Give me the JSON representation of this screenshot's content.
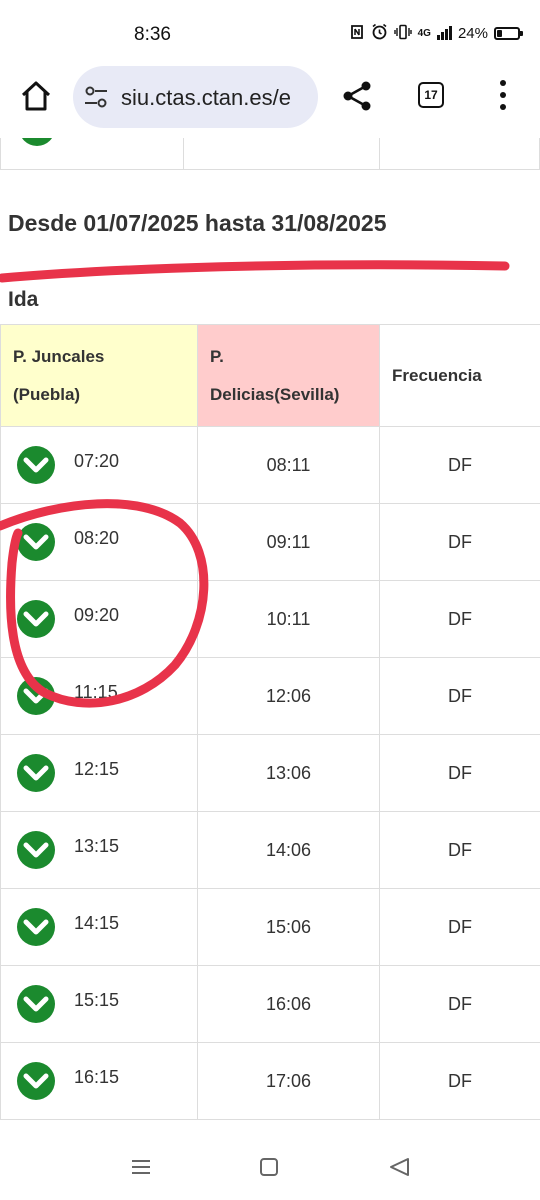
{
  "status": {
    "time": "8:36",
    "network_label": "4G",
    "battery": "24%",
    "battery_level": 0.24
  },
  "browser": {
    "url": "siu.ctas.ctan.es/e",
    "tab_count": "17"
  },
  "page": {
    "range_title": "Desde 01/07/2025 hasta 31/08/2025",
    "section_title": "Ida",
    "columns": {
      "origin_line1": "P. Juncales",
      "origin_line2": "(Puebla)",
      "dest_line1": "P.",
      "dest_line2": "Delicias(Sevilla)",
      "frequency": "Frecuencia"
    },
    "rows": [
      {
        "departure": "07:20",
        "arrival": "08:11",
        "frequency": "DF"
      },
      {
        "departure": "08:20",
        "arrival": "09:11",
        "frequency": "DF"
      },
      {
        "departure": "09:20",
        "arrival": "10:11",
        "frequency": "DF"
      },
      {
        "departure": "11:15",
        "arrival": "12:06",
        "frequency": "DF"
      },
      {
        "departure": "12:15",
        "arrival": "13:06",
        "frequency": "DF"
      },
      {
        "departure": "13:15",
        "arrival": "14:06",
        "frequency": "DF"
      },
      {
        "departure": "14:15",
        "arrival": "15:06",
        "frequency": "DF"
      },
      {
        "departure": "15:15",
        "arrival": "16:06",
        "frequency": "DF"
      },
      {
        "departure": "16:15",
        "arrival": "17:06",
        "frequency": "DF"
      }
    ]
  },
  "colors": {
    "icon_green": "#1b8a2e",
    "origin_header_bg": "#ffffcc",
    "dest_header_bg": "#ffcccc",
    "annotation_red": "#e8334a"
  }
}
